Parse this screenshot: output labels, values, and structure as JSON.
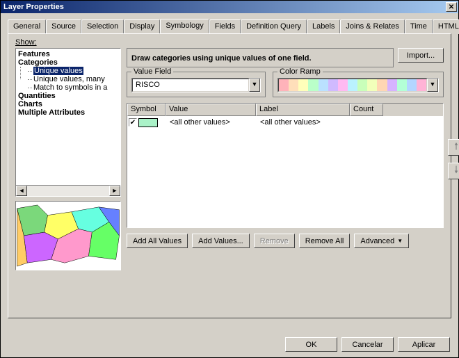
{
  "window": {
    "title": "Layer Properties"
  },
  "tabs": [
    "General",
    "Source",
    "Selection",
    "Display",
    "Symbology",
    "Fields",
    "Definition Query",
    "Labels",
    "Joins & Relates",
    "Time",
    "HTML Popup"
  ],
  "active_tab": "Symbology",
  "show": {
    "label": "Show:",
    "items": {
      "features": "Features",
      "categories": "Categories",
      "cat_unique": "Unique values",
      "cat_unique_many": "Unique values, many",
      "cat_match": "Match to symbols in a",
      "quantities": "Quantities",
      "charts": "Charts",
      "multi": "Multiple Attributes"
    }
  },
  "desc": {
    "text": "Draw categories using unique values of one field.",
    "import": "Import..."
  },
  "value_field": {
    "legend": "Value Field",
    "value": "RISCO"
  },
  "color_ramp": {
    "legend": "Color Ramp",
    "colors": [
      "#ffb3ba",
      "#ffdfba",
      "#ffffba",
      "#baffc9",
      "#bae1ff",
      "#d0baff",
      "#ffbaf2",
      "#baf2ff",
      "#c9ffba",
      "#f2ffba",
      "#ffd6b3",
      "#d6b3ff",
      "#b3ffd6",
      "#b3d6ff",
      "#ffb3d6"
    ]
  },
  "grid": {
    "headers": {
      "symbol": "Symbol",
      "value": "Value",
      "label": "Label",
      "count": "Count"
    },
    "rows": [
      {
        "checked": true,
        "value": "<all other values>",
        "label": "<all other values>",
        "count": ""
      }
    ]
  },
  "actions": {
    "add_all": "Add All Values",
    "add_values": "Add Values...",
    "remove": "Remove",
    "remove_all": "Remove All",
    "advanced": "Advanced"
  },
  "footer": {
    "ok": "OK",
    "cancel": "Cancelar",
    "apply": "Aplicar"
  }
}
